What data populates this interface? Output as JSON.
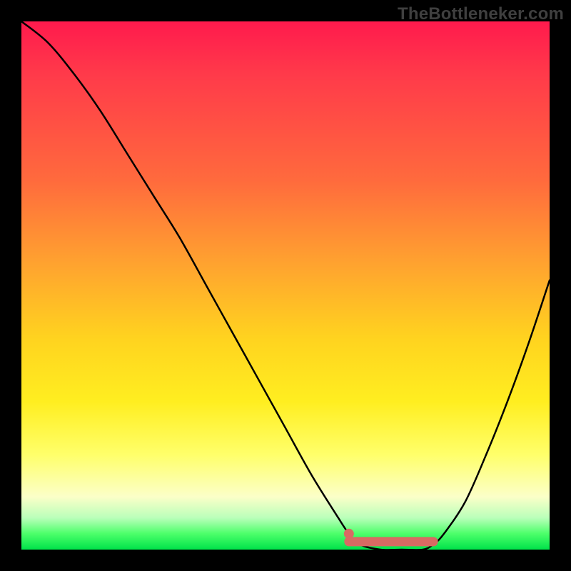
{
  "watermark": "TheBottleneker.com",
  "chart_data": {
    "type": "line",
    "title": "",
    "xlabel": "",
    "ylabel": "",
    "xlim": [
      0,
      100
    ],
    "ylim": [
      0,
      100
    ],
    "grid": false,
    "legend": false,
    "series": [
      {
        "name": "curve",
        "color": "#000000",
        "x": [
          0,
          5,
          10,
          15,
          20,
          25,
          30,
          35,
          40,
          45,
          50,
          55,
          60,
          62,
          64,
          68,
          72,
          76,
          78,
          80,
          84,
          88,
          92,
          96,
          100
        ],
        "y": [
          100,
          96,
          90,
          83,
          75,
          67,
          59,
          50,
          41,
          32,
          23,
          14,
          6,
          3,
          1,
          0,
          0,
          0,
          1,
          3,
          9,
          18,
          28,
          39,
          51
        ]
      },
      {
        "name": "highlight-band",
        "color": "#d86a63",
        "x": [
          62,
          78
        ],
        "y": [
          1.5,
          1.5
        ]
      },
      {
        "name": "highlight-dot",
        "color": "#d86a63",
        "x": [
          62
        ],
        "y": [
          3
        ]
      }
    ],
    "gradient_stops": [
      {
        "pos": 0,
        "color": "#ff1a4d"
      },
      {
        "pos": 10,
        "color": "#ff3a4a"
      },
      {
        "pos": 30,
        "color": "#ff6a3d"
      },
      {
        "pos": 46,
        "color": "#ffa32f"
      },
      {
        "pos": 60,
        "color": "#ffd31f"
      },
      {
        "pos": 72,
        "color": "#ffee20"
      },
      {
        "pos": 82,
        "color": "#ffff6a"
      },
      {
        "pos": 90,
        "color": "#fbffc8"
      },
      {
        "pos": 94,
        "color": "#baffba"
      },
      {
        "pos": 97,
        "color": "#4cff6a"
      },
      {
        "pos": 100,
        "color": "#00e24a"
      }
    ]
  }
}
